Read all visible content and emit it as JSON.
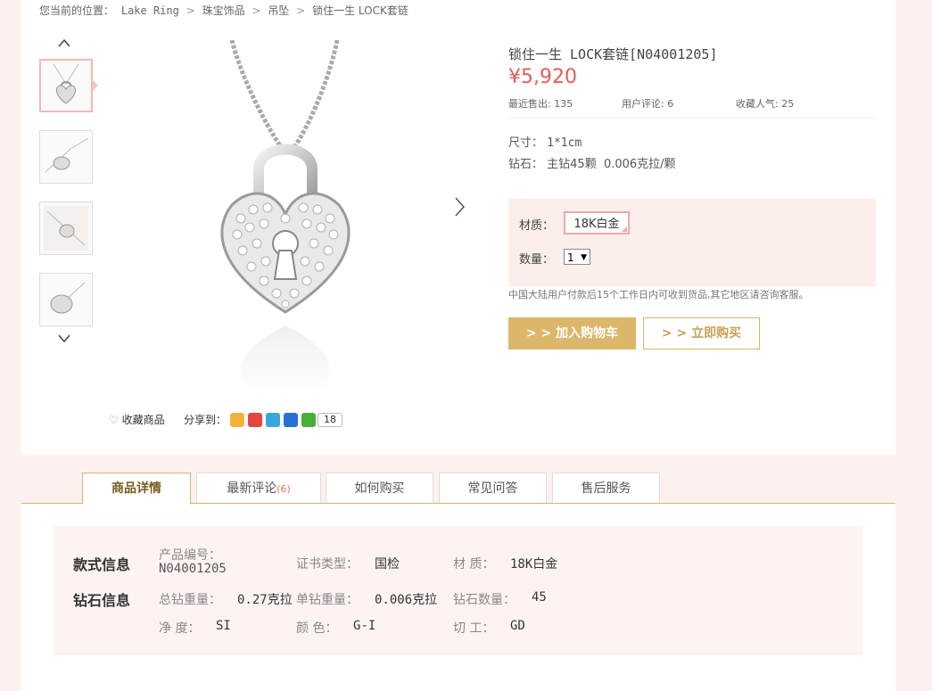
{
  "breadcrumb": {
    "prefix": "您当前的位置：",
    "items": [
      "Lake Ring",
      "珠宝饰品",
      "吊坠",
      "锁住一生 LOCK套链"
    ],
    "separator": ">"
  },
  "gallery": {
    "thumbnail_count": 4,
    "active_index": 0
  },
  "actions": {
    "favorite_label": "收藏商品",
    "share_label": "分享到：",
    "share_count": "18"
  },
  "product": {
    "title": "锁住一生 LOCK套链[N04001205]",
    "price": "¥5,920",
    "sold_label": "最近售出:",
    "sold_value": "135",
    "reviews_label": "用户评论:",
    "reviews_value": "6",
    "fav_label": "收藏人气:",
    "fav_value": "25",
    "size_label": "尺寸：",
    "size_value": "1*1cm",
    "diamond_label": "钻石：",
    "diamond_value": "主钻45颗  0.006克拉/颗"
  },
  "options": {
    "material_label": "材质：",
    "material_value": "18K白金",
    "quantity_label": "数量：",
    "quantity_value": "1"
  },
  "notice": "中国大陆用户付款后15个工作日内可收到货品,其它地区请咨询客服。",
  "buttons": {
    "add_to_cart": "> > 加入购物车",
    "buy_now": "> > 立即购买"
  },
  "tabs": [
    {
      "label": "商品详情",
      "count": ""
    },
    {
      "label": "最新评论",
      "count": "(6)"
    },
    {
      "label": "如何购买",
      "count": ""
    },
    {
      "label": "常见问答",
      "count": ""
    },
    {
      "label": "售后服务",
      "count": ""
    }
  ],
  "details": {
    "style_heading": "款式信息",
    "diamond_heading": "钻石信息",
    "product_no_label": "产品编号：",
    "product_no_value": "N04001205",
    "cert_label": "证书类型：",
    "cert_value": "国检",
    "material_label": "材 质：",
    "material_value": "18K白金",
    "total_weight_label": "总钻重量：",
    "total_weight_value": "0.27克拉",
    "single_weight_label": "单钻重量：",
    "single_weight_value": "0.006克拉",
    "count_label": "钻石数量：",
    "count_value": "45",
    "clarity_label": "净 度：",
    "clarity_value": "SI",
    "color_label": "颜 色：",
    "color_value": "G-I",
    "cut_label": "切 工：",
    "cut_value": "GD"
  },
  "colors": {
    "page_bg": "#fdf1ef",
    "price": "#ea5a5a",
    "gold": "#dcb66a",
    "active_thumb_border": "#f2b8b8"
  }
}
